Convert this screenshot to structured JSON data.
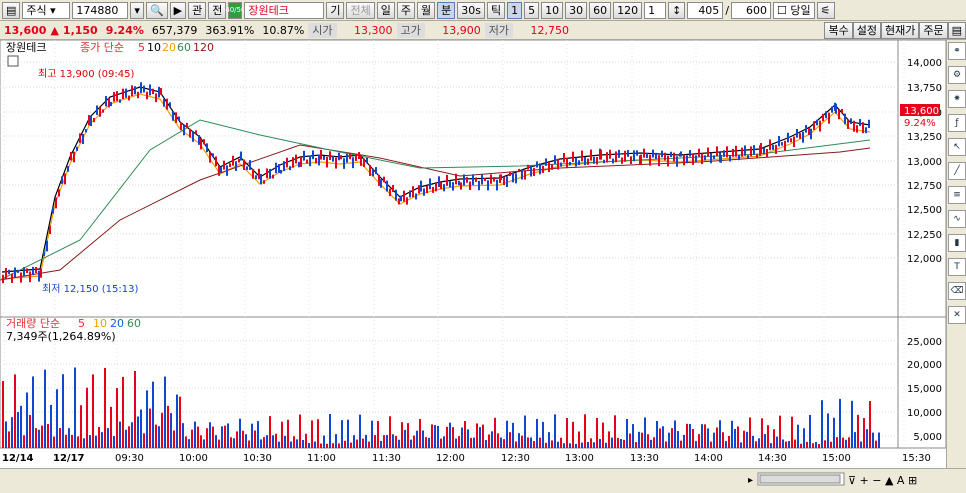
{
  "toolbar": {
    "market": "주식",
    "code": "174880",
    "btn_watch": "관",
    "btn_all": "전",
    "stock_badge": "40/50",
    "stock_name": "장원테크",
    "btn_gi": "기",
    "btn_jeonche": "전체",
    "period_tabs": [
      "일",
      "주",
      "월",
      "분",
      "30s",
      "틱"
    ],
    "interval_tabs": [
      "1",
      "5",
      "10",
      "30",
      "60",
      "120"
    ],
    "unit_value": "1",
    "range_current": "405",
    "range_sep": "/",
    "range_total": "600",
    "today_label": "당일"
  },
  "quote": {
    "price": "13,600",
    "change_arrow": "▲",
    "change": "1,150",
    "change_pct": "9.24%",
    "volume": "657,379",
    "vol_ratio": "363.91%",
    "turnover": "10.87%",
    "open_label": "시가",
    "open": "13,300",
    "high_label": "고가",
    "high": "13,900",
    "low_label": "저가",
    "low": "12,750",
    "btns": [
      "복수",
      "설정",
      "현재가",
      "주문"
    ]
  },
  "price_panel": {
    "title": "장원테크",
    "ma_label": "종가 단순",
    "ma_periods": [
      "5",
      "10",
      "20",
      "60",
      "120"
    ],
    "ma_colors": [
      "#e03030",
      "#000000",
      "#f0a000",
      "#2e8b57",
      "#8b1a1a"
    ],
    "high_note": "최고 13,900 (09:45)",
    "low_note": "최저 12,150 (15:13)",
    "yticks": [
      "14,000",
      "13,750",
      "13,500",
      "13,250",
      "13,000",
      "12,750",
      "12,500",
      "12,250",
      "12,000"
    ],
    "current_price_tag": "13,600",
    "current_pct_tag": "9.24%"
  },
  "volume_panel": {
    "title": "거래량 단순",
    "ma_periods": [
      "5",
      "10",
      "20",
      "60"
    ],
    "ma_colors": [
      "#e03030",
      "#f0a000",
      "#1060d0",
      "#2e8b57"
    ],
    "vol_note": "7,349주(1,264.89%)",
    "yticks": [
      "25,000",
      "20,000",
      "15,000",
      "10,000",
      "5,000"
    ]
  },
  "xaxis": [
    "12/14",
    "12/17",
    "09:30",
    "10:00",
    "10:30",
    "11:00",
    "11:30",
    "12:00",
    "12:30",
    "13:00",
    "13:30",
    "14:00",
    "14:30",
    "15:00",
    "15:30"
  ],
  "colors": {
    "up": "#e8001a",
    "down": "#1046d0",
    "grid": "#d9d9d9"
  }
}
